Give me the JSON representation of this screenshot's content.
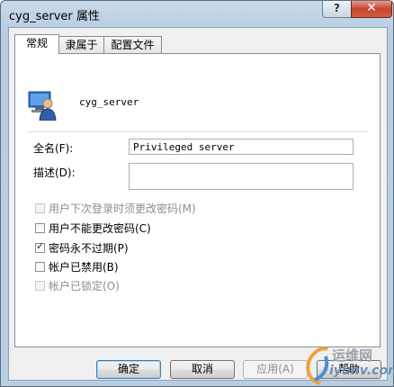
{
  "window": {
    "title": "cyg_server 属性",
    "help_label": "?",
    "close_label": "✕"
  },
  "tabs": [
    {
      "label": "常规",
      "active": true
    },
    {
      "label": "隶属于",
      "active": false
    },
    {
      "label": "配置文件",
      "active": false
    }
  ],
  "general": {
    "username": "cyg_server",
    "fullname_label": "全名(F):",
    "fullname_value": "Privileged server",
    "description_label": "描述(D):",
    "description_value": ""
  },
  "checkboxes": [
    {
      "label": "用户下次登录时须更改密码(M)",
      "checked": false,
      "disabled": true
    },
    {
      "label": "用户不能更改密码(C)",
      "checked": false,
      "disabled": false
    },
    {
      "label": "密码永不过期(P)",
      "checked": true,
      "disabled": false
    },
    {
      "label": "帐户已禁用(B)",
      "checked": false,
      "disabled": false
    },
    {
      "label": "帐户已锁定(O)",
      "checked": false,
      "disabled": true
    }
  ],
  "buttons": {
    "ok": "确定",
    "cancel": "取消",
    "apply": "应用(A)",
    "help": "帮助"
  },
  "watermark": {
    "top_text": "运维网",
    "bottom_text": "iyunv.com"
  },
  "colors": {
    "titlebar": "#b9cee3",
    "close_button": "#c8462f",
    "icon_blue": "#2a6fc9"
  },
  "icons": {
    "user": "user-icon",
    "check": "check-icon"
  }
}
